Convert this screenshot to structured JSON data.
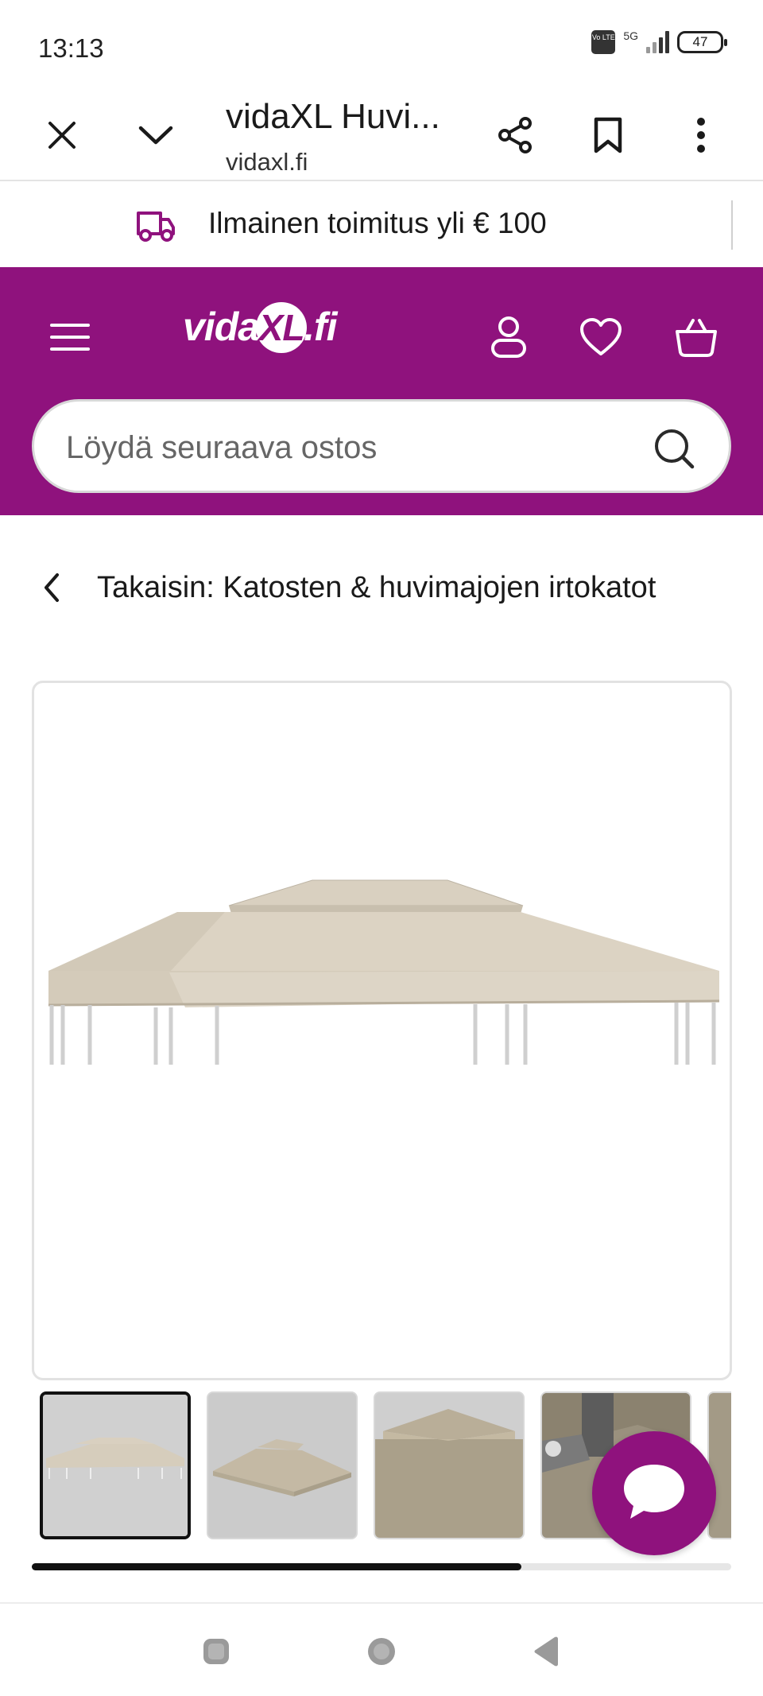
{
  "status_bar": {
    "time": "13:13",
    "network": "5G",
    "volte": "Vo LTE",
    "battery": "47"
  },
  "browser": {
    "title": "vidaXL Huvi...",
    "url": "vidaxl.fi",
    "icons": [
      "close-icon",
      "chevron-down-icon",
      "share-icon",
      "bookmark-icon",
      "more-vert-icon"
    ]
  },
  "promo": {
    "text": "Ilmainen toimitus yli € 100",
    "icon": "truck-icon"
  },
  "header": {
    "logo_prefix": "vida",
    "logo_xl": "XL",
    "logo_suffix": ".fi",
    "icons": [
      "menu-icon",
      "account-icon",
      "heart-icon",
      "basket-icon"
    ],
    "search_placeholder": "Löydä seuraava ostos"
  },
  "breadcrumb": {
    "back_label": "Takaisin: Katosten & huvimajojen irtokatot"
  },
  "gallery": {
    "thumbnail_count_visible": 5,
    "active_index": 0,
    "scroll_progress": 0.7
  },
  "colors": {
    "brand": "#8f127d",
    "canopy": "#d6cdbc",
    "thumb_bg": "#c9c9c9"
  }
}
